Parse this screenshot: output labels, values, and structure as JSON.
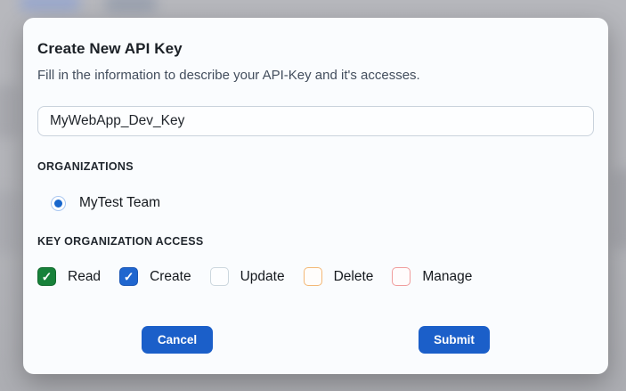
{
  "modal": {
    "title": "Create New API Key",
    "subtitle": "Fill in the information to describe your API-Key and it's accesses.",
    "name_input": {
      "value": "MyWebApp_Dev_Key",
      "placeholder": ""
    },
    "organizations": {
      "label": "ORGANIZATIONS",
      "options": [
        {
          "label": "MyTest Team",
          "selected": true
        }
      ],
      "radio_dot_color": "#1766cc",
      "radio_ring_color": "#a9c7f1"
    },
    "access": {
      "label": "KEY ORGANIZATION ACCESS",
      "options": [
        {
          "label": "Read",
          "checked": true,
          "fill": "#17813a",
          "border": "#136b30"
        },
        {
          "label": "Create",
          "checked": true,
          "fill": "#1f66cf",
          "border": "#1a56b5"
        },
        {
          "label": "Update",
          "checked": false,
          "fill": "#fdfeff",
          "border": "#ccd7de"
        },
        {
          "label": "Delete",
          "checked": false,
          "fill": "#fffdfb",
          "border": "#f3b876"
        },
        {
          "label": "Manage",
          "checked": false,
          "fill": "#fffcfc",
          "border": "#f09c9c"
        }
      ],
      "check_glyph": "✓"
    },
    "buttons": {
      "cancel": "Cancel",
      "submit": "Submit",
      "color": "#1b5fc9"
    }
  }
}
